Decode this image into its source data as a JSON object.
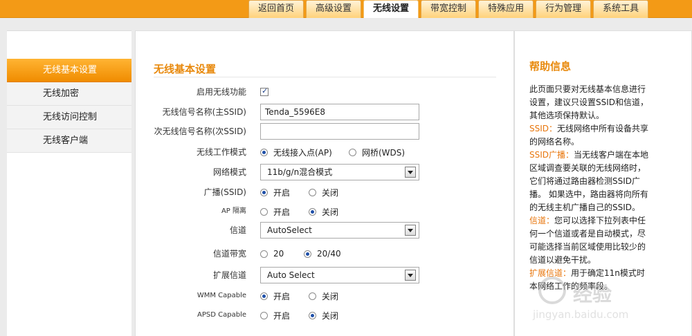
{
  "nav": {
    "tabs": [
      {
        "label": "返回首页"
      },
      {
        "label": "高级设置"
      },
      {
        "label": "无线设置",
        "active": true
      },
      {
        "label": "带宽控制"
      },
      {
        "label": "特殊应用"
      },
      {
        "label": "行为管理"
      },
      {
        "label": "系统工具"
      }
    ]
  },
  "sidebar": {
    "items": [
      {
        "label": "无线基本设置",
        "active": true
      },
      {
        "label": "无线加密"
      },
      {
        "label": "无线访问控制"
      },
      {
        "label": "无线客户端"
      }
    ]
  },
  "main": {
    "title": "无线基本设置",
    "enable_wireless": {
      "label": "启用无线功能",
      "checked": true
    },
    "ssid_primary": {
      "label": "无线信号名称(主SSID)",
      "value": "Tenda_5596E8"
    },
    "ssid_secondary": {
      "label": "次无线信号名称(次SSID)",
      "value": ""
    },
    "work_mode": {
      "label": "无线工作模式",
      "options": [
        "无线接入点(AP)",
        "网桥(WDS)"
      ],
      "selected": "无线接入点(AP)"
    },
    "network_mode": {
      "label": "网络模式",
      "value": "11b/g/n混合模式"
    },
    "broadcast": {
      "label": "广播(SSID)",
      "options": [
        "开启",
        "关闭"
      ],
      "selected": "开启"
    },
    "ap_isolation": {
      "label": "AP 隔离",
      "options": [
        "开启",
        "关闭"
      ],
      "selected": "关闭"
    },
    "channel": {
      "label": "信道",
      "value": "AutoSelect"
    },
    "bandwidth": {
      "label": "信道带宽",
      "options": [
        "20",
        "20/40"
      ],
      "selected": "20/40"
    },
    "ext_channel": {
      "label": "扩展信道",
      "value": "Auto Select"
    },
    "wmm": {
      "label": "WMM Capable",
      "options": [
        "开启",
        "关闭"
      ],
      "selected": "开启"
    },
    "apsd": {
      "label": "APSD Capable",
      "options": [
        "开启",
        "关闭"
      ],
      "selected": "关闭"
    }
  },
  "help": {
    "title": "帮助信息",
    "intro": "此页面只要对无线基本信息进行设置，建议只设置SSID和信道，其他选项保持默认。",
    "ssid_key": "SSID：",
    "ssid_text": "无线网络中所有设备共享的网络名称。",
    "bcast_key": "SSID广播：",
    "bcast_text": "当无线客户端在本地区域调查要关联的无线网络时，它们将通过路由器检测SSID广播。 如果选中，路由器将向所有的无线主机广播自己的SSID。",
    "chan_key": "信道：",
    "chan_text": "您可以选择下拉列表中任何一个信道或者是自动模式，尽可能选择当前区域使用比较少的信道以避免干扰。",
    "ext_key": "扩展信道：",
    "ext_text": "用于确定11n模式时本网络工作的频率段。"
  },
  "watermark": {
    "text": "经验",
    "url": "jingyan.baidu.com"
  }
}
